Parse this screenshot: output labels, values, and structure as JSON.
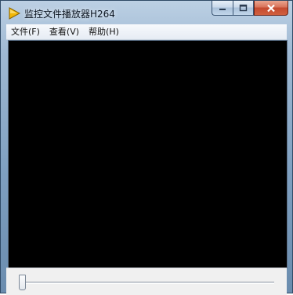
{
  "window": {
    "title": "监控文件播放器H264",
    "icon": "play-triangle-icon"
  },
  "menu": {
    "items": [
      {
        "label": "文件(F)"
      },
      {
        "label": "查看(V)"
      },
      {
        "label": "帮助(H)"
      }
    ]
  },
  "playback": {
    "position": 0
  },
  "colors": {
    "video_background": "#000000",
    "close_button": "#c44a2f"
  }
}
